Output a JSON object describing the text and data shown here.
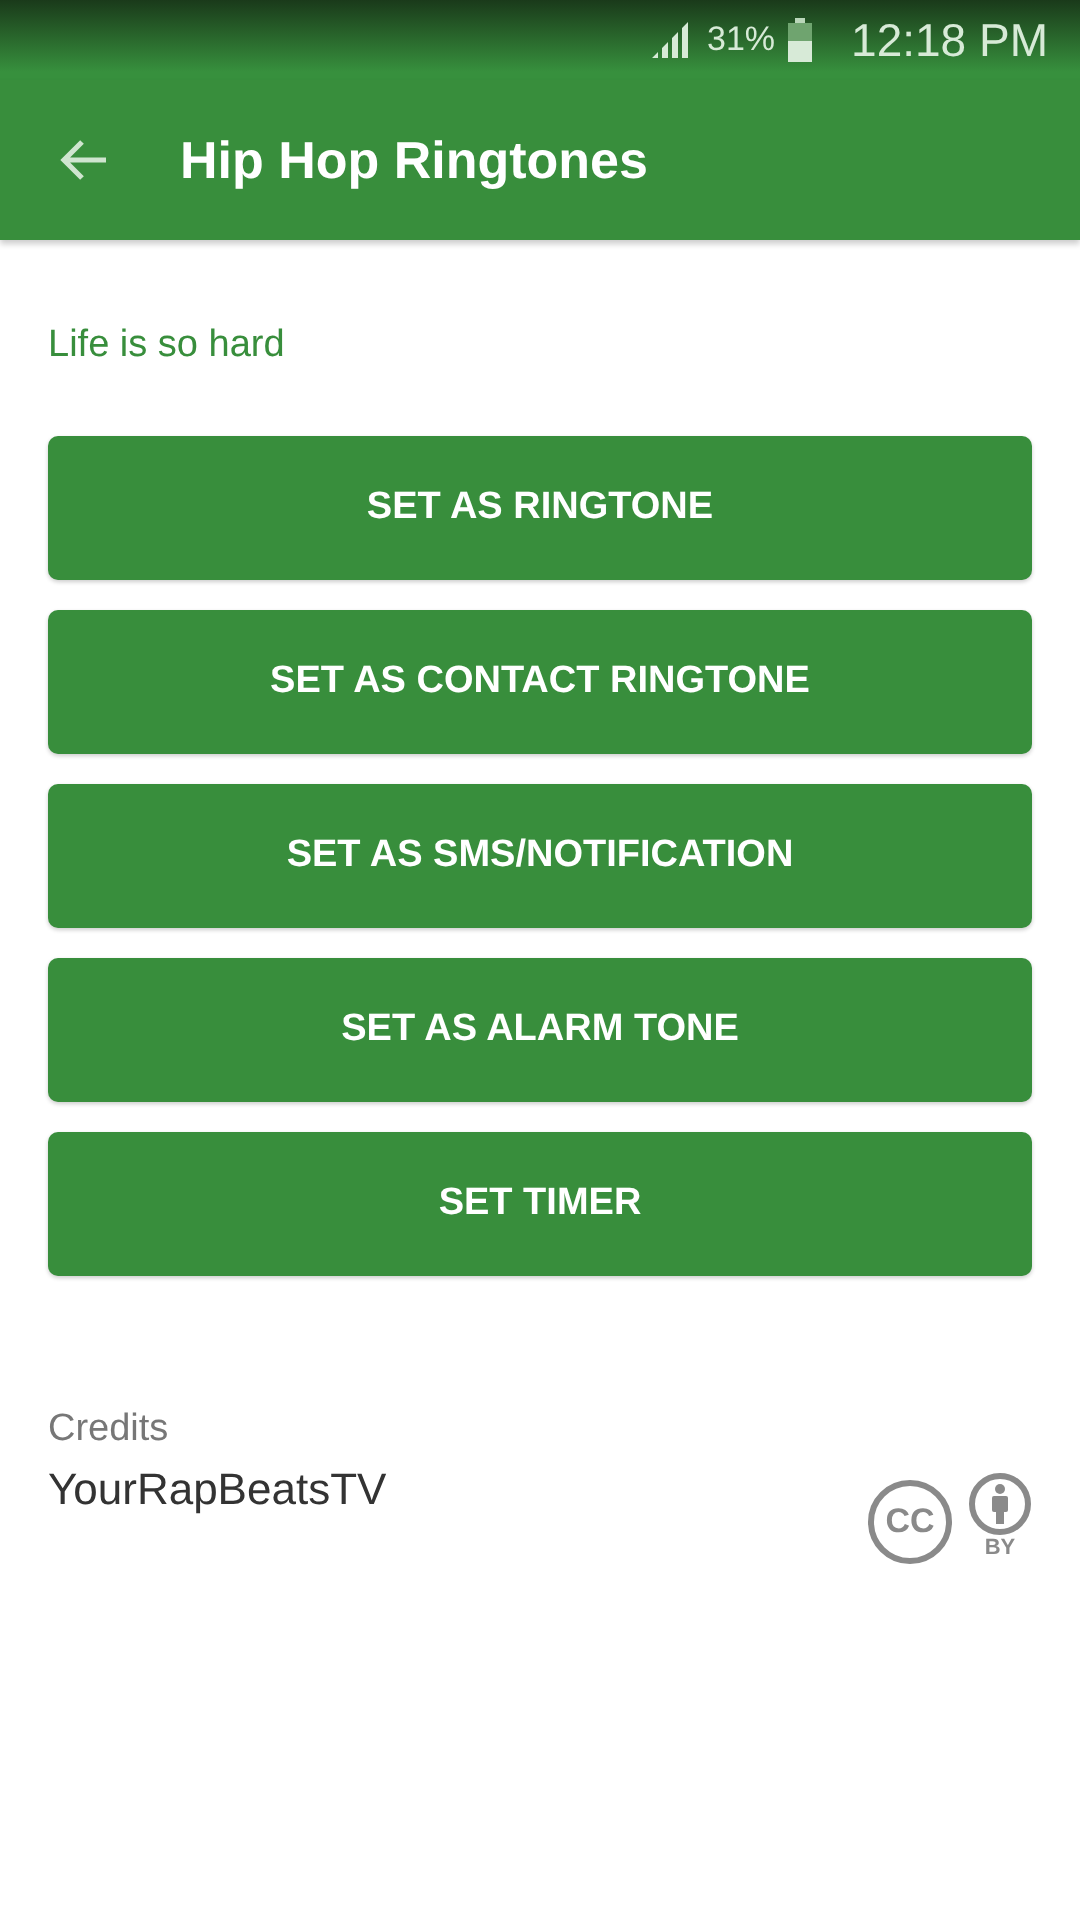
{
  "status_bar": {
    "battery_text": "31%",
    "time": "12:18 PM"
  },
  "toolbar": {
    "title": "Hip Hop Ringtones"
  },
  "song_title": "Life is so hard",
  "buttons": [
    "SET AS RINGTONE",
    "SET AS CONTACT RINGTONE",
    "SET AS SMS/NOTIFICATION",
    "SET AS ALARM TONE",
    "SET TIMER"
  ],
  "credits": {
    "label": "Credits",
    "author": "YourRapBeatsTV",
    "license_cc": "CC",
    "license_by": "BY"
  }
}
